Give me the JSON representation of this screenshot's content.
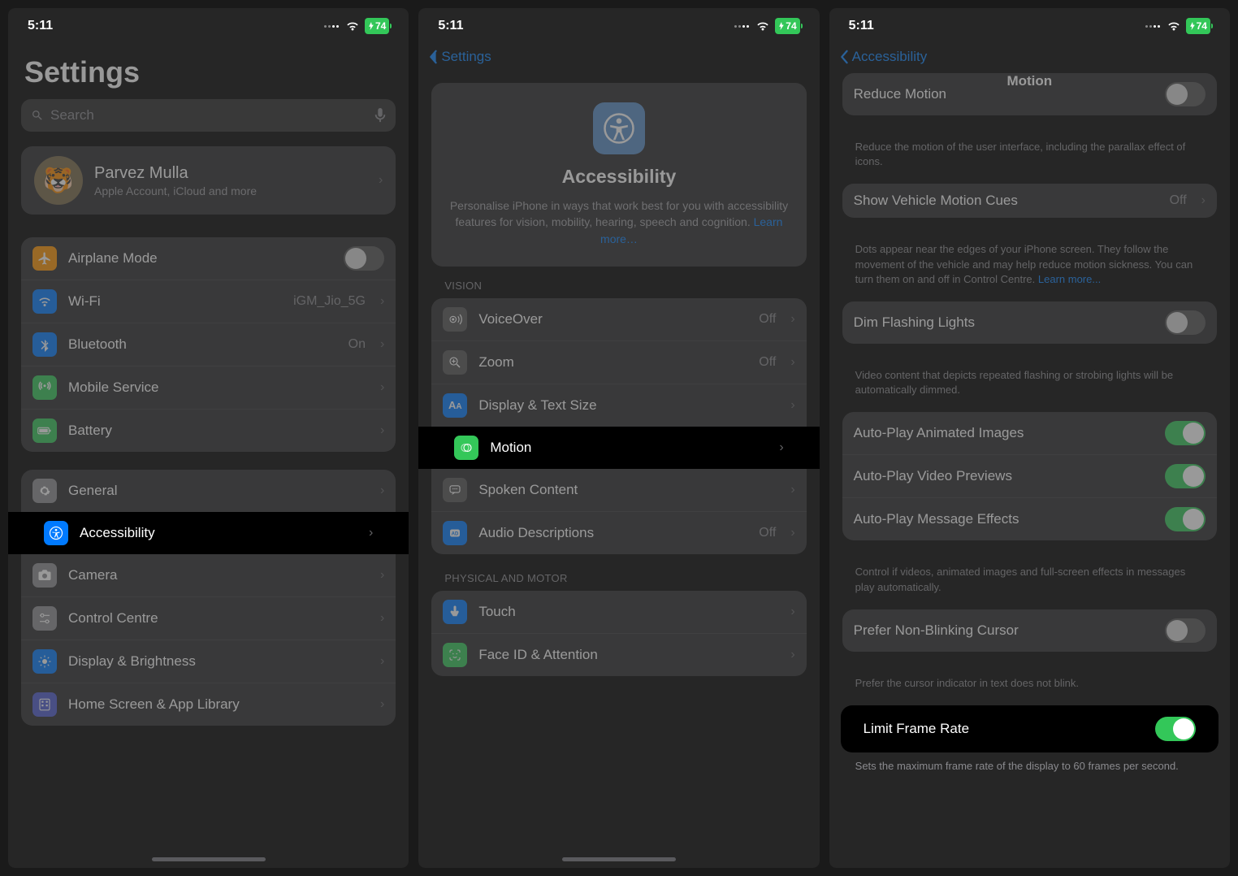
{
  "status": {
    "time": "5:11",
    "battery": "74"
  },
  "p1": {
    "title": "Settings",
    "search_placeholder": "Search",
    "profile": {
      "name": "Parvez Mulla",
      "sub": "Apple Account, iCloud and more"
    },
    "g1": {
      "airplane": "Airplane Mode",
      "wifi": "Wi-Fi",
      "wifi_val": "iGM_Jio_5G",
      "bt": "Bluetooth",
      "bt_val": "On",
      "mobile": "Mobile Service",
      "battery": "Battery"
    },
    "g2": {
      "general": "General",
      "accessibility": "Accessibility",
      "camera": "Camera",
      "control": "Control Centre",
      "display": "Display & Brightness",
      "home": "Home Screen & App Library"
    }
  },
  "p2": {
    "back": "Settings",
    "header_title": "Accessibility",
    "header_body": "Personalise iPhone in ways that work best for you with accessibility features for vision, mobility, hearing, speech and cognition.",
    "learn": "Learn more…",
    "sec_vision": "VISION",
    "voiceover": "VoiceOver",
    "voiceover_val": "Off",
    "zoom": "Zoom",
    "zoom_val": "Off",
    "display_text": "Display & Text Size",
    "motion": "Motion",
    "spoken": "Spoken Content",
    "audio": "Audio Descriptions",
    "audio_val": "Off",
    "sec_pm": "PHYSICAL AND MOTOR",
    "touch": "Touch",
    "faceid": "Face ID & Attention"
  },
  "p3": {
    "back": "Accessibility",
    "title": "Motion",
    "reduce": "Reduce Motion",
    "reduce_foot": "Reduce the motion of the user interface, including the parallax effect of icons.",
    "vehicle": "Show Vehicle Motion Cues",
    "vehicle_val": "Off",
    "vehicle_foot": "Dots appear near the edges of your iPhone screen. They follow the movement of the vehicle and may help reduce motion sickness. You can turn them on and off in Control Centre.",
    "learn": " Learn more...",
    "dim": "Dim Flashing Lights",
    "dim_foot": "Video content that depicts repeated flashing or strobing lights will be automatically dimmed.",
    "auto_img": "Auto-Play Animated Images",
    "auto_vid": "Auto-Play Video Previews",
    "auto_msg": "Auto-Play Message Effects",
    "auto_foot": "Control if videos, animated images and full-screen effects in messages play automatically.",
    "cursor": "Prefer Non-Blinking Cursor",
    "cursor_foot": "Prefer the cursor indicator in text does not blink.",
    "limit": "Limit Frame Rate",
    "limit_foot": "Sets the maximum frame rate of the display to 60 frames per second."
  }
}
